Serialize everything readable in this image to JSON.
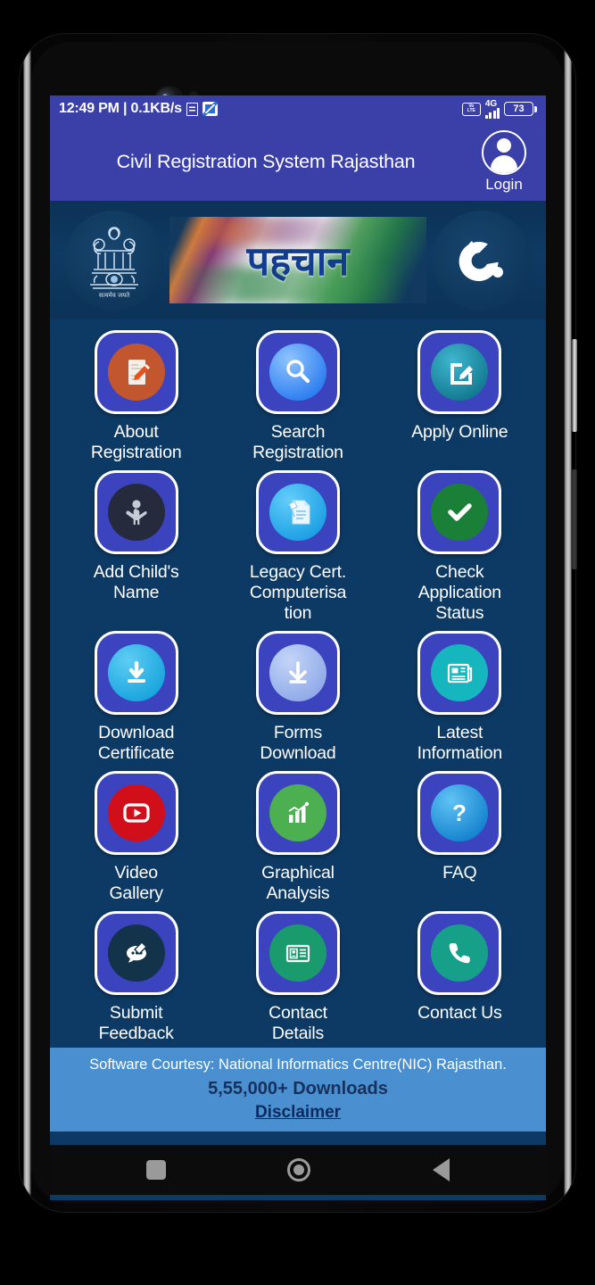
{
  "status_bar": {
    "time_and_speed": "12:49 PM | 0.1KB/s",
    "doc_icon": "document-icon",
    "app_icon": "app-notification-icon",
    "volte_line1": "Vo",
    "volte_line2": "LTE",
    "network": "4G",
    "battery_level": "73"
  },
  "app_bar": {
    "title": "Civil Registration System Rajasthan",
    "login_label": "Login",
    "avatar_icon": "user-avatar-icon",
    "background_color": "#3b3fa8"
  },
  "banner": {
    "emblem_icon": "india-national-emblem-icon",
    "emblem_motto": "सत्यमेव जयते",
    "center_logo_text": "पहचान",
    "right_logo_icon": "swirl-logo-icon"
  },
  "grid": {
    "tiles": [
      {
        "label": "About\nRegistration",
        "icon": "document-pencil-icon",
        "icon_color": "#c2562f"
      },
      {
        "label": "Search\nRegistration",
        "icon": "magnifier-icon",
        "icon_color": "#3d8ef0"
      },
      {
        "label": "Apply Online",
        "icon": "edit-square-icon",
        "icon_color": "#1b8fa8"
      },
      {
        "label": "Add Child's\nName",
        "icon": "child-icon",
        "icon_color": "#252b3d"
      },
      {
        "label": "Legacy Cert.\nComputerisa\ntion",
        "icon": "legacy-document-icon",
        "icon_color": "#29b0f0"
      },
      {
        "label": "Check\nApplication\nStatus",
        "icon": "check-circle-icon",
        "icon_color": "#1b8037"
      },
      {
        "label": "Download\nCertificate",
        "icon": "download-icon",
        "icon_color": "#29b0e8"
      },
      {
        "label": "Forms\nDownload",
        "icon": "download-arrow-icon",
        "icon_color": "#9cb6ef"
      },
      {
        "label": "Latest\nInformation",
        "icon": "newspaper-icon",
        "icon_color": "#15b6bd"
      },
      {
        "label": "Video\nGallery",
        "icon": "youtube-play-icon",
        "icon_color": "#d10f1b"
      },
      {
        "label": "Graphical\nAnalysis",
        "icon": "bar-chart-icon",
        "icon_color": "#4caf50"
      },
      {
        "label": "FAQ",
        "icon": "question-mark-icon",
        "icon_color": "#2196e8"
      },
      {
        "label": "Submit\nFeedback",
        "icon": "feedback-chat-icon",
        "icon_color": "#123349"
      },
      {
        "label": "Contact\nDetails",
        "icon": "id-card-icon",
        "icon_color": "#199b6e"
      },
      {
        "label": "Contact Us",
        "icon": "phone-icon",
        "icon_color": "#16a08a"
      }
    ],
    "tile_color": "#3c43bf",
    "page_background": "#0d3a64"
  },
  "footer": {
    "courtesy": "Software Courtesy: National Informatics Centre(NIC) Rajasthan.",
    "downloads": "5,55,000+ Downloads",
    "disclaimer": "Disclaimer",
    "background_color": "#4a90d0"
  },
  "nav_bar": {
    "recents": "recents-square-icon",
    "home": "home-circle-icon",
    "back": "back-triangle-icon"
  }
}
